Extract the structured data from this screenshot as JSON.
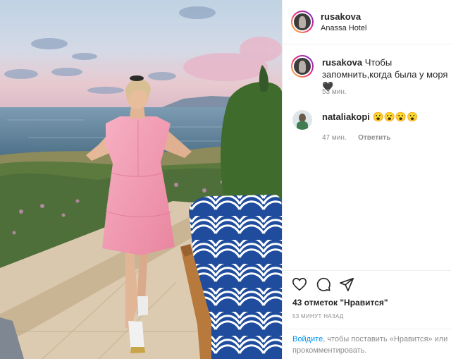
{
  "post": {
    "username": "rusakova",
    "location": "Anassa Hotel"
  },
  "caption": {
    "username": "rusakova",
    "text": "Чтобы запомнить,когда была у моря 🖤",
    "time": "53 мин."
  },
  "comments": [
    {
      "username": "nataliakopi",
      "text": "😮😮😮😮",
      "time": "47 мин.",
      "reply_label": "Ответить"
    }
  ],
  "actions": {
    "like_icon": "heart-icon",
    "comment_icon": "comment-icon",
    "share_icon": "paper-plane-icon"
  },
  "likes_text": "43 отметок \"Нравится\"",
  "posted_ago": "53 МИНУТ НАЗАД",
  "login_prompt": {
    "link": "Войдите",
    "text_line1": ", чтобы поставить «Нравится» или",
    "text_line2": "прокомментировать."
  },
  "colors": {
    "link": "#0095f6",
    "muted": "#8e8e8e",
    "text": "#262626",
    "dress": "#f29ab2",
    "sea": "#5b7f97"
  }
}
